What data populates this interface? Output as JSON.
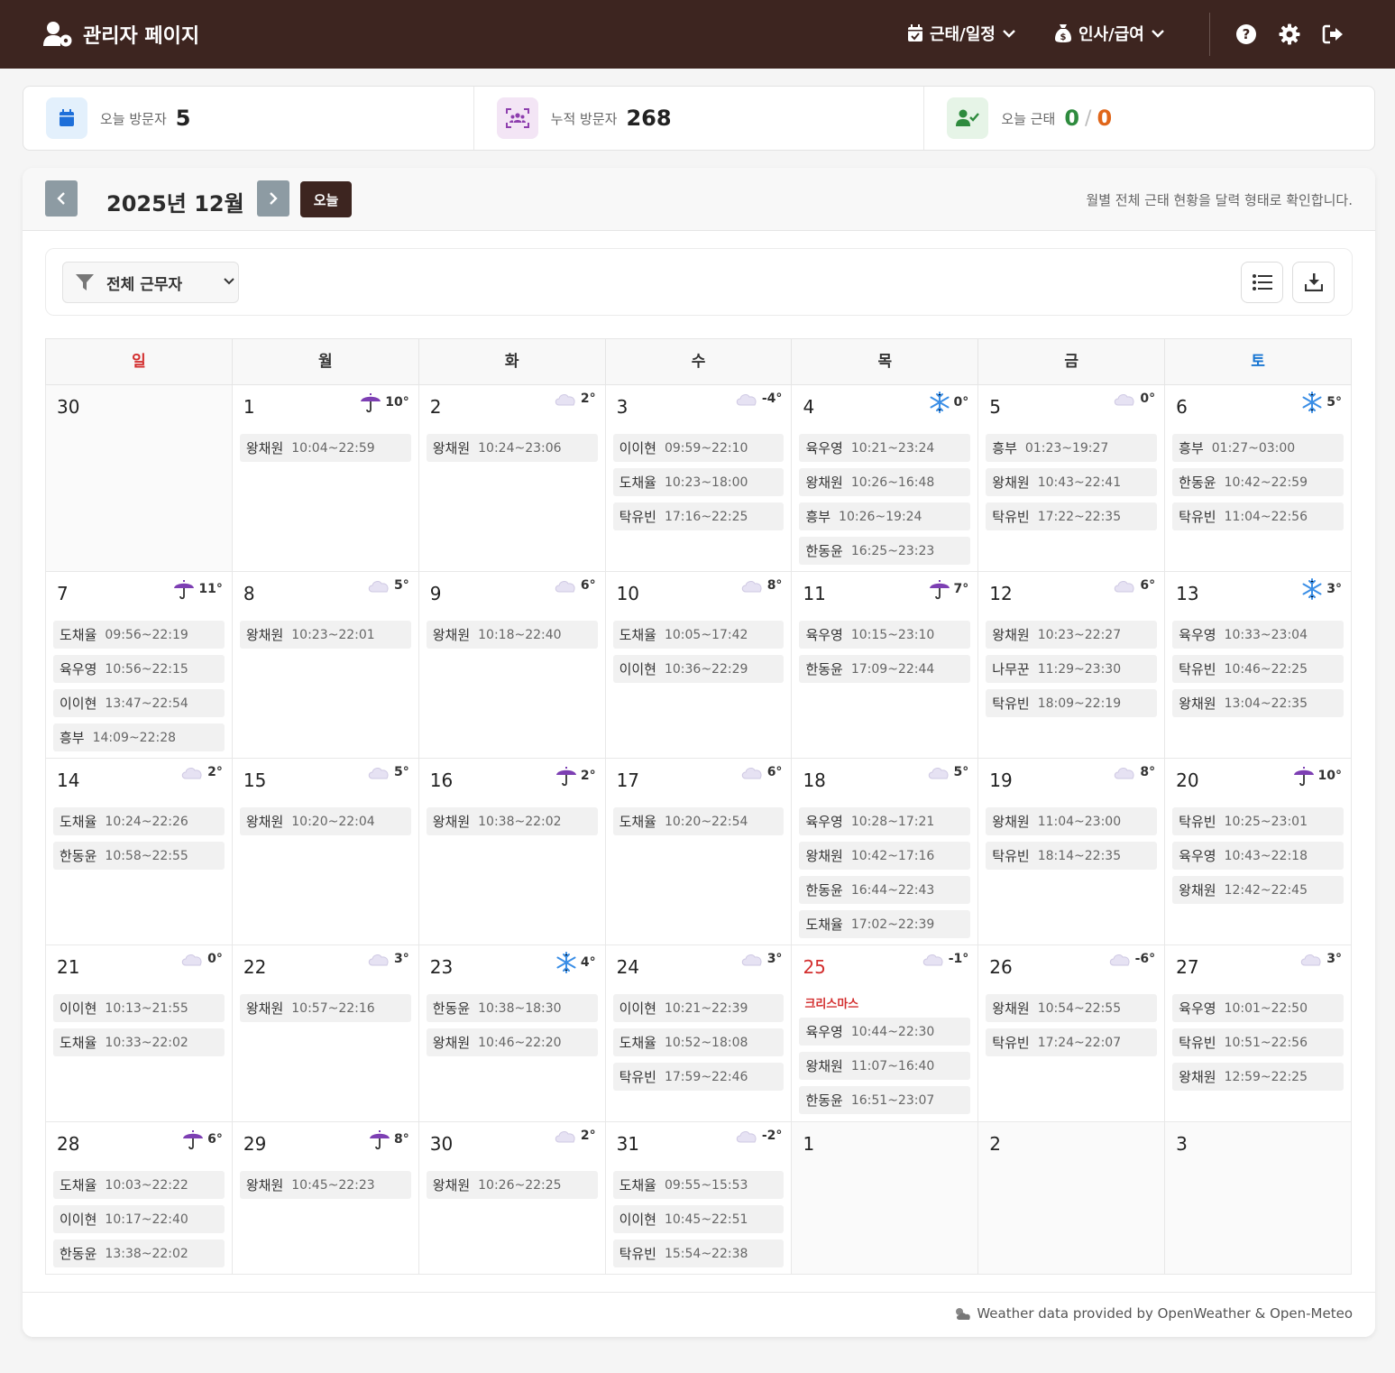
{
  "header": {
    "title": "관리자 페이지",
    "menu_attendance": "근태/일정",
    "menu_hr": "인사/급여"
  },
  "stats": {
    "today_visitors_label": "오늘 방문자",
    "today_visitors_value": "5",
    "total_visitors_label": "누적 방문자",
    "total_visitors_value": "268",
    "today_attendance_label": "오늘 근태",
    "today_attendance_present": "0",
    "today_attendance_slash": "/",
    "today_attendance_absent": "0"
  },
  "calendar": {
    "title": "2025년 12월",
    "today_label": "오늘",
    "description": "월별 전체 근태 현황을 달력 형태로 확인합니다.",
    "filter_value": "전체 근무자",
    "weekdays": [
      "일",
      "월",
      "화",
      "수",
      "목",
      "금",
      "토"
    ],
    "weeks": [
      [
        {
          "date": "30",
          "other": true,
          "shifts": []
        },
        {
          "date": "1",
          "weather": "rain",
          "temp": "10°",
          "shifts": [
            {
              "name": "왕채원",
              "time": "10:04~22:59"
            }
          ]
        },
        {
          "date": "2",
          "weather": "cloud",
          "temp": "2°",
          "shifts": [
            {
              "name": "왕채원",
              "time": "10:24~23:06"
            }
          ]
        },
        {
          "date": "3",
          "weather": "cloud",
          "temp": "-4°",
          "shifts": [
            {
              "name": "이이현",
              "time": "09:59~22:10"
            },
            {
              "name": "도채율",
              "time": "10:23~18:00"
            },
            {
              "name": "탁유빈",
              "time": "17:16~22:25"
            }
          ]
        },
        {
          "date": "4",
          "weather": "snow",
          "temp": "0°",
          "shifts": [
            {
              "name": "육우영",
              "time": "10:21~23:24"
            },
            {
              "name": "왕채원",
              "time": "10:26~16:48"
            },
            {
              "name": "흥부",
              "time": "10:26~19:24"
            },
            {
              "name": "한동윤",
              "time": "16:25~23:23"
            }
          ]
        },
        {
          "date": "5",
          "weather": "cloud",
          "temp": "0°",
          "shifts": [
            {
              "name": "흥부",
              "time": "01:23~19:27"
            },
            {
              "name": "왕채원",
              "time": "10:43~22:41"
            },
            {
              "name": "탁유빈",
              "time": "17:22~22:35"
            }
          ]
        },
        {
          "date": "6",
          "weather": "snow",
          "temp": "5°",
          "shifts": [
            {
              "name": "흥부",
              "time": "01:27~03:00"
            },
            {
              "name": "한동윤",
              "time": "10:42~22:59"
            },
            {
              "name": "탁유빈",
              "time": "11:04~22:56"
            }
          ]
        }
      ],
      [
        {
          "date": "7",
          "weather": "rain",
          "temp": "11°",
          "shifts": [
            {
              "name": "도채율",
              "time": "09:56~22:19"
            },
            {
              "name": "육우영",
              "time": "10:56~22:15"
            },
            {
              "name": "이이현",
              "time": "13:47~22:54"
            },
            {
              "name": "흥부",
              "time": "14:09~22:28"
            }
          ]
        },
        {
          "date": "8",
          "weather": "cloud",
          "temp": "5°",
          "shifts": [
            {
              "name": "왕채원",
              "time": "10:23~22:01"
            }
          ]
        },
        {
          "date": "9",
          "weather": "cloud",
          "temp": "6°",
          "shifts": [
            {
              "name": "왕채원",
              "time": "10:18~22:40"
            }
          ]
        },
        {
          "date": "10",
          "weather": "cloud",
          "temp": "8°",
          "shifts": [
            {
              "name": "도채율",
              "time": "10:05~17:42"
            },
            {
              "name": "이이현",
              "time": "10:36~22:29"
            }
          ]
        },
        {
          "date": "11",
          "weather": "rain",
          "temp": "7°",
          "shifts": [
            {
              "name": "육우영",
              "time": "10:15~23:10"
            },
            {
              "name": "한동윤",
              "time": "17:09~22:44"
            }
          ]
        },
        {
          "date": "12",
          "weather": "cloud",
          "temp": "6°",
          "shifts": [
            {
              "name": "왕채원",
              "time": "10:23~22:27"
            },
            {
              "name": "나무꾼",
              "time": "11:29~23:30"
            },
            {
              "name": "탁유빈",
              "time": "18:09~22:19"
            }
          ]
        },
        {
          "date": "13",
          "weather": "snow",
          "temp": "3°",
          "shifts": [
            {
              "name": "육우영",
              "time": "10:33~23:04"
            },
            {
              "name": "탁유빈",
              "time": "10:46~22:25"
            },
            {
              "name": "왕채원",
              "time": "13:04~22:35"
            }
          ]
        }
      ],
      [
        {
          "date": "14",
          "weather": "cloud",
          "temp": "2°",
          "shifts": [
            {
              "name": "도채율",
              "time": "10:24~22:26"
            },
            {
              "name": "한동윤",
              "time": "10:58~22:55"
            }
          ]
        },
        {
          "date": "15",
          "weather": "cloud",
          "temp": "5°",
          "shifts": [
            {
              "name": "왕채원",
              "time": "10:20~22:04"
            }
          ]
        },
        {
          "date": "16",
          "weather": "rain",
          "temp": "2°",
          "shifts": [
            {
              "name": "왕채원",
              "time": "10:38~22:02"
            }
          ]
        },
        {
          "date": "17",
          "weather": "cloud",
          "temp": "6°",
          "shifts": [
            {
              "name": "도채율",
              "time": "10:20~22:54"
            }
          ]
        },
        {
          "date": "18",
          "weather": "cloud",
          "temp": "5°",
          "shifts": [
            {
              "name": "육우영",
              "time": "10:28~17:21"
            },
            {
              "name": "왕채원",
              "time": "10:42~17:16"
            },
            {
              "name": "한동윤",
              "time": "16:44~22:43"
            },
            {
              "name": "도채율",
              "time": "17:02~22:39"
            }
          ]
        },
        {
          "date": "19",
          "weather": "cloud",
          "temp": "8°",
          "shifts": [
            {
              "name": "왕채원",
              "time": "11:04~23:00"
            },
            {
              "name": "탁유빈",
              "time": "18:14~22:35"
            }
          ]
        },
        {
          "date": "20",
          "weather": "rain",
          "temp": "10°",
          "shifts": [
            {
              "name": "탁유빈",
              "time": "10:25~23:01"
            },
            {
              "name": "육우영",
              "time": "10:43~22:18"
            },
            {
              "name": "왕채원",
              "time": "12:42~22:45"
            }
          ]
        }
      ],
      [
        {
          "date": "21",
          "weather": "cloud",
          "temp": "0°",
          "shifts": [
            {
              "name": "이이현",
              "time": "10:13~21:55"
            },
            {
              "name": "도채율",
              "time": "10:33~22:02"
            }
          ]
        },
        {
          "date": "22",
          "weather": "cloud",
          "temp": "3°",
          "shifts": [
            {
              "name": "왕채원",
              "time": "10:57~22:16"
            }
          ]
        },
        {
          "date": "23",
          "weather": "snow",
          "temp": "4°",
          "shifts": [
            {
              "name": "한동윤",
              "time": "10:38~18:30"
            },
            {
              "name": "왕채원",
              "time": "10:46~22:20"
            }
          ]
        },
        {
          "date": "24",
          "weather": "cloud",
          "temp": "3°",
          "shifts": [
            {
              "name": "이이현",
              "time": "10:21~22:39"
            },
            {
              "name": "도채율",
              "time": "10:52~18:08"
            },
            {
              "name": "탁유빈",
              "time": "17:59~22:46"
            }
          ]
        },
        {
          "date": "25",
          "holiday": "크리스마스",
          "weather": "cloud",
          "temp": "-1°",
          "shifts": [
            {
              "name": "육우영",
              "time": "10:44~22:30"
            },
            {
              "name": "왕채원",
              "time": "11:07~16:40"
            },
            {
              "name": "한동윤",
              "time": "16:51~23:07"
            }
          ]
        },
        {
          "date": "26",
          "weather": "cloud",
          "temp": "-6°",
          "shifts": [
            {
              "name": "왕채원",
              "time": "10:54~22:55"
            },
            {
              "name": "탁유빈",
              "time": "17:24~22:07"
            }
          ]
        },
        {
          "date": "27",
          "weather": "cloud",
          "temp": "3°",
          "shifts": [
            {
              "name": "육우영",
              "time": "10:01~22:50"
            },
            {
              "name": "탁유빈",
              "time": "10:51~22:56"
            },
            {
              "name": "왕채원",
              "time": "12:59~22:25"
            }
          ]
        }
      ],
      [
        {
          "date": "28",
          "weather": "rain",
          "temp": "6°",
          "shifts": [
            {
              "name": "도채율",
              "time": "10:03~22:22"
            },
            {
              "name": "이이현",
              "time": "10:17~22:40"
            },
            {
              "name": "한동윤",
              "time": "13:38~22:02"
            }
          ]
        },
        {
          "date": "29",
          "weather": "rain",
          "temp": "8°",
          "shifts": [
            {
              "name": "왕채원",
              "time": "10:45~22:23"
            }
          ]
        },
        {
          "date": "30",
          "weather": "cloud",
          "temp": "2°",
          "shifts": [
            {
              "name": "왕채원",
              "time": "10:26~22:25"
            }
          ]
        },
        {
          "date": "31",
          "weather": "cloud",
          "temp": "-2°",
          "shifts": [
            {
              "name": "도채율",
              "time": "09:55~15:53"
            },
            {
              "name": "이이현",
              "time": "10:45~22:51"
            },
            {
              "name": "탁유빈",
              "time": "15:54~22:38"
            }
          ]
        },
        {
          "date": "1",
          "other": true,
          "shifts": []
        },
        {
          "date": "2",
          "other": true,
          "shifts": []
        },
        {
          "date": "3",
          "other": true,
          "shifts": []
        }
      ]
    ],
    "footer": "Weather data provided by OpenWeather & Open-Meteo"
  },
  "colors": {
    "header_bg": "#3d2520",
    "sunday": "#d32f2f",
    "saturday": "#1976d2",
    "present": "#2e8b3e",
    "absent": "#e0661a"
  }
}
